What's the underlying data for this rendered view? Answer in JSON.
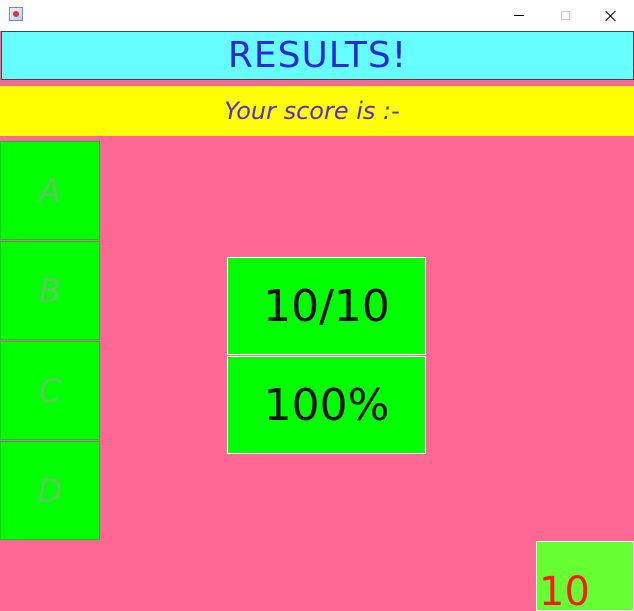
{
  "window": {
    "icon": "java-app-icon",
    "controls": [
      "minimize-icon",
      "maximize-icon",
      "close-icon"
    ]
  },
  "header": {
    "title": "RESULTS!"
  },
  "banner": {
    "text": "Your score is :-"
  },
  "options": [
    {
      "label": "A"
    },
    {
      "label": "B"
    },
    {
      "label": "C"
    },
    {
      "label": "D"
    }
  ],
  "score": {
    "fraction": "10/10",
    "percent": "100%"
  },
  "counter": {
    "value": "10"
  },
  "colors": {
    "background": "#ff6894",
    "header_bg": "#66ffff",
    "header_text": "#2b2bd6",
    "banner_bg": "#ffff00",
    "banner_text": "#5b2cd0",
    "option_bg": "#00ff00",
    "option_text": "#5ec85e",
    "counter_bg": "#66ff33",
    "counter_text": "#ff1a1a"
  }
}
